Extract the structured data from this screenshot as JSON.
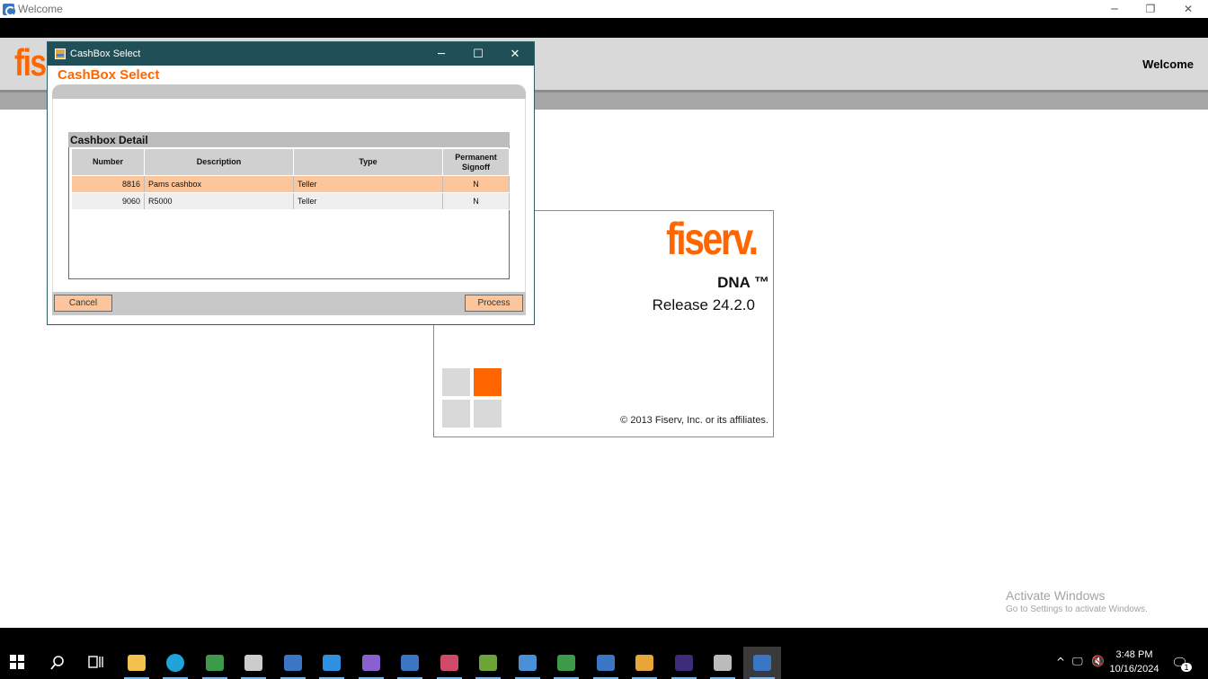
{
  "window": {
    "title": "Welcome",
    "minimize_glyph": "─",
    "restore_glyph": "❐",
    "close_glyph": "✕"
  },
  "app_header": {
    "logo_partial": "fis",
    "welcome_label": "Welcome"
  },
  "splash": {
    "brand": "fiserv.",
    "product": "DNA ™",
    "release": "Release 24.2.0",
    "copyright": "© 2013 Fiserv, Inc. or its affiliates.",
    "tile_colors": {
      "gray": "#d9d9d9",
      "accent": "#ff6600"
    }
  },
  "dialog": {
    "title": "CashBox Select",
    "heading": "CashBox Select",
    "minimize_glyph": "─",
    "maximize_glyph": "☐",
    "close_glyph": "✕",
    "section_title": "Cashbox Detail",
    "columns": [
      "Number",
      "Description",
      "Type",
      "Permanent Signoff"
    ],
    "rows": [
      {
        "number": "8816",
        "description": "Pams cashbox",
        "type": "Teller",
        "signoff": "N",
        "selected": true
      },
      {
        "number": "9060",
        "description": "R5000",
        "type": "Teller",
        "signoff": "N",
        "selected": false
      }
    ],
    "cancel_label": "Cancel",
    "process_label": "Process"
  },
  "watermark": {
    "line1": "Activate Windows",
    "line2": "Go to Settings to activate Windows."
  },
  "taskbar": {
    "apps": [
      {
        "name": "windows-start",
        "color": "#ffffff"
      },
      {
        "name": "search",
        "color": "#ffffff"
      },
      {
        "name": "task-view",
        "color": "#ffffff"
      },
      {
        "name": "file-explorer",
        "color": "#f2c14e"
      },
      {
        "name": "edge",
        "color": "#1fa3d8"
      },
      {
        "name": "app-green-play",
        "color": "#3c9a4a"
      },
      {
        "name": "terminal",
        "color": "#cccccc"
      },
      {
        "name": "app-c-blue",
        "color": "#3a76c4"
      },
      {
        "name": "vscode",
        "color": "#2f8fe0"
      },
      {
        "name": "visual-studio",
        "color": "#8a5fd0"
      },
      {
        "name": "app-blue-window",
        "color": "#3a76c4"
      },
      {
        "name": "app-brain",
        "color": "#d04a6a"
      },
      {
        "name": "app-chart",
        "color": "#6ea33a"
      },
      {
        "name": "app-document",
        "color": "#4a90d8"
      },
      {
        "name": "app-green-play-2",
        "color": "#3c9a4a"
      },
      {
        "name": "app-blue-square",
        "color": "#3a76c4"
      },
      {
        "name": "git",
        "color": "#e8a53a"
      },
      {
        "name": "eclipse",
        "color": "#3c2c7a"
      },
      {
        "name": "app-printer",
        "color": "#bbbbbb"
      },
      {
        "name": "app-c-active",
        "color": "#3a76c4"
      }
    ],
    "tray": {
      "time": "3:48 PM",
      "date": "10/16/2024",
      "notification_count": "1",
      "chevron_glyph": "^",
      "network_glyph": "🖵",
      "volume_glyph": "🔇",
      "notification_glyph": "🗨"
    }
  }
}
